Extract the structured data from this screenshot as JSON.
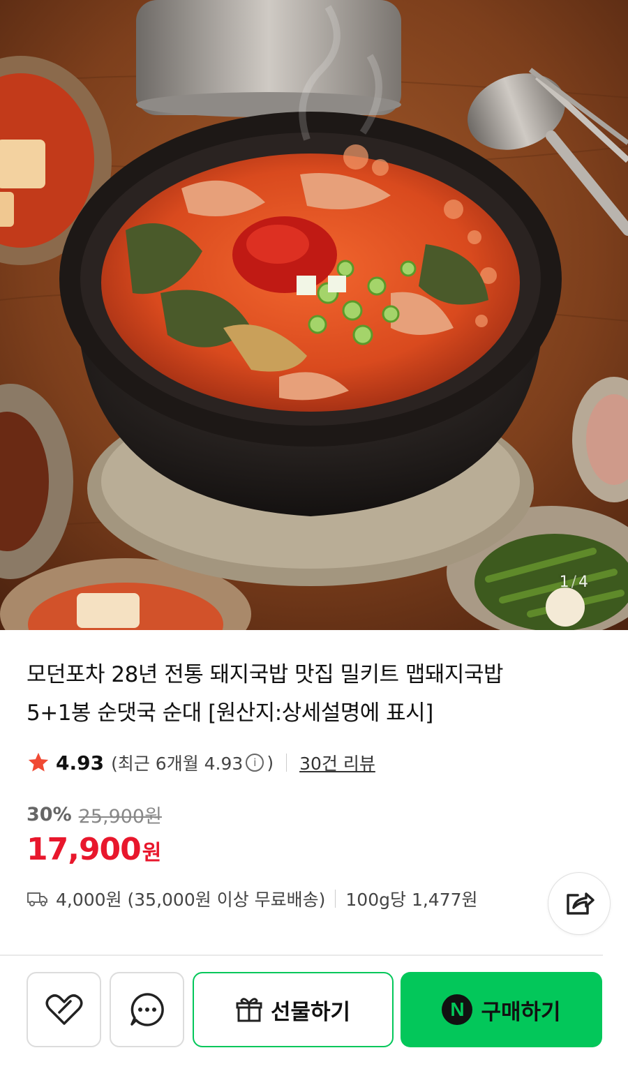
{
  "gallery": {
    "current": "1",
    "separator": "/",
    "total": "4"
  },
  "product": {
    "title_line1": "모던포차 28년 전통 돼지국밥 맛집 밀키트 맵돼지국밥",
    "title_line2": "5+1봉 순댓국 순대 [원산지:상세설명에 표시]"
  },
  "rating": {
    "score": "4.93",
    "recent_prefix": "(최근 6개월 4.93",
    "recent_suffix": ")",
    "reviews_link": "30건 리뷰"
  },
  "price": {
    "discount_rate": "30%",
    "original": "25,900원",
    "sale": "17,900",
    "sale_unit": "원"
  },
  "shipping": {
    "fee_text": "4,000원 (35,000원 이상 무료배송)",
    "unit_price": "100g당 1,477원"
  },
  "actions": {
    "gift_label": "선물하기",
    "buy_label": "구매하기",
    "buy_badge": "N"
  },
  "colors": {
    "accent_green": "#03c75a",
    "sale_red": "#e8172c",
    "star": "#f04a34"
  }
}
